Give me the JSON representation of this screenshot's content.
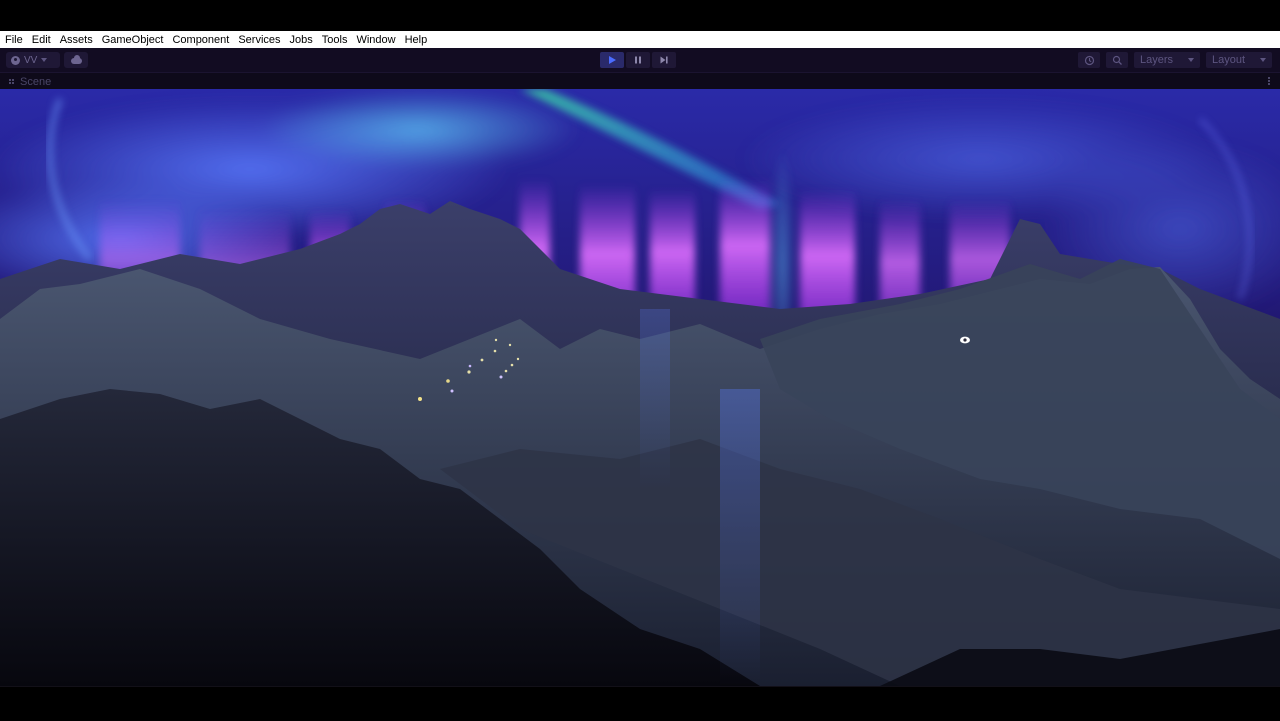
{
  "menu": {
    "items": [
      "File",
      "Edit",
      "Assets",
      "GameObject",
      "Component",
      "Services",
      "Jobs",
      "Tools",
      "Window",
      "Help"
    ]
  },
  "toolbar": {
    "account_label": "VV",
    "layers_label": "Layers",
    "layout_label": "Layout"
  },
  "scene_tab": {
    "label": "Scene"
  },
  "colors": {
    "menu_bg": "#ffffff",
    "toolbar_bg": "#120c22",
    "play_active": "#3a4ad8",
    "aurora_purple": "#b03cff",
    "aurora_green": "#3cd6a0",
    "mountain": "#3a4358"
  }
}
